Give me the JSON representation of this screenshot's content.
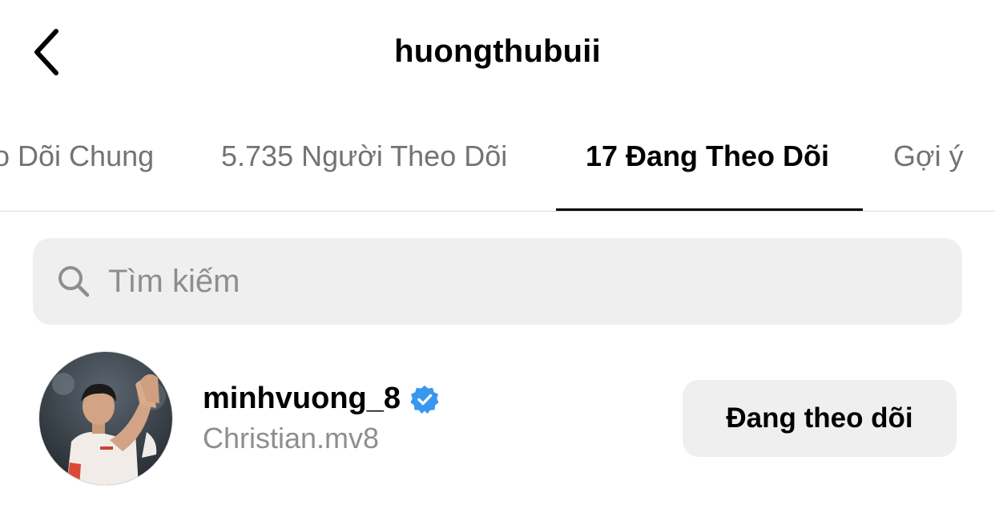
{
  "header": {
    "title": "huongthubuii",
    "back_icon": "chevron-left-icon"
  },
  "tabs": [
    {
      "label": "Người Theo Dõi Chung",
      "visible_text": "o Dõi Chung",
      "active": false
    },
    {
      "label": "5.735 Người Theo Dõi",
      "active": false
    },
    {
      "label": "17 Đang Theo Dõi",
      "active": true
    },
    {
      "label": "Gợi ý",
      "active": false
    }
  ],
  "search": {
    "placeholder": "Tìm kiếm",
    "value": "",
    "icon": "search-icon"
  },
  "users": [
    {
      "username": "minhvuong_8",
      "verified": true,
      "full_name": "Christian.mv8",
      "button_label": "Đang theo dõi",
      "avatar_icon": "avatar"
    }
  ],
  "colors": {
    "text_primary": "#000000",
    "text_secondary": "#8e8e8e",
    "tab_inactive": "#737373",
    "search_bg": "#efefef",
    "button_bg": "#efefef",
    "divider": "#dbdbdb",
    "verified_blue": "#3897f0"
  }
}
